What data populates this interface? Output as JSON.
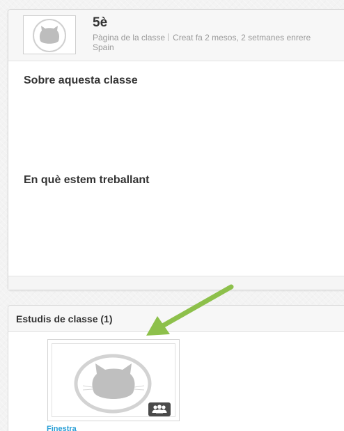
{
  "class": {
    "name": "5è",
    "page_label": "Pàgina de la classe",
    "created": "Creat fa 2 mesos, 2 setmanes enrere",
    "country": "Spain",
    "about_heading": "Sobre aquesta classe",
    "working_heading": "En què estem treballant"
  },
  "studies": {
    "heading": "Estudis de classe (1)",
    "items": [
      {
        "name": "Finestra",
        "badge_icon": "group-icon"
      }
    ]
  },
  "icons": {
    "class_avatar": "cat-avatar-icon",
    "study_thumbnail": "cat-avatar-icon",
    "badge": "group-icon"
  },
  "colors": {
    "link": "#2a9fd6",
    "arrow": "#8dc04b",
    "avatar_fill": "#bdbdbd",
    "badge_bg": "#4a4a4a"
  }
}
